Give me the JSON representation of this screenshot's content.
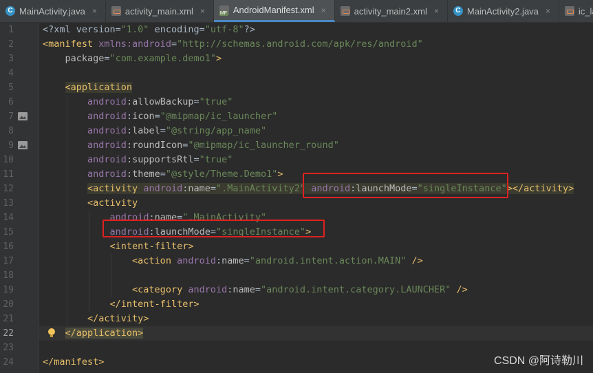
{
  "tabs": [
    {
      "name": "MainActivity.java",
      "icon": "class-icon",
      "active": false
    },
    {
      "name": "activity_main.xml",
      "icon": "xml-file-icon",
      "active": false
    },
    {
      "name": "AndroidManifest.xml",
      "icon": "manifest-file-icon",
      "active": true
    },
    {
      "name": "activity_main2.xml",
      "icon": "xml-file-icon",
      "active": false
    },
    {
      "name": "MainActivity2.java",
      "icon": "class-icon",
      "active": false
    },
    {
      "name": "ic_launcher_r",
      "icon": "xml-file-icon",
      "active": false
    }
  ],
  "close_glyph": "×",
  "current_line": 22,
  "lines": [
    [
      [
        "t-plain",
        "<?xml version="
      ],
      [
        "t-val",
        "\"1.0\""
      ],
      [
        "t-plain",
        " encoding="
      ],
      [
        "t-val",
        "\"utf-8\""
      ],
      [
        "t-plain",
        "?>"
      ]
    ],
    [
      [
        "t-tag",
        "<manifest "
      ],
      [
        "t-ns",
        "xmlns:android"
      ],
      [
        "t-plain",
        "="
      ],
      [
        "t-val",
        "\"http://schemas.android.com/apk/res/android\""
      ]
    ],
    [
      [
        "t-plain",
        "    "
      ],
      [
        "t-attr",
        "package"
      ],
      [
        "t-plain",
        "="
      ],
      [
        "t-val",
        "\"com.example.demo1\""
      ],
      [
        "t-tag",
        ">"
      ]
    ],
    [],
    [
      [
        "t-plain",
        "    "
      ],
      [
        "t-tag hl",
        "<application"
      ]
    ],
    [
      [
        "t-plain",
        "        "
      ],
      [
        "t-ns",
        "android"
      ],
      [
        "t-plain",
        ":"
      ],
      [
        "t-attr",
        "allowBackup"
      ],
      [
        "t-plain",
        "="
      ],
      [
        "t-val",
        "\"true\""
      ]
    ],
    [
      [
        "t-plain",
        "        "
      ],
      [
        "t-ns",
        "android"
      ],
      [
        "t-plain",
        ":"
      ],
      [
        "t-attr",
        "icon"
      ],
      [
        "t-plain",
        "="
      ],
      [
        "t-val",
        "\"@mipmap/ic_launcher\""
      ]
    ],
    [
      [
        "t-plain",
        "        "
      ],
      [
        "t-ns",
        "android"
      ],
      [
        "t-plain",
        ":"
      ],
      [
        "t-attr",
        "label"
      ],
      [
        "t-plain",
        "="
      ],
      [
        "t-val",
        "\"@string/app_name\""
      ]
    ],
    [
      [
        "t-plain",
        "        "
      ],
      [
        "t-ns",
        "android"
      ],
      [
        "t-plain",
        ":"
      ],
      [
        "t-attr",
        "roundIcon"
      ],
      [
        "t-plain",
        "="
      ],
      [
        "t-val",
        "\"@mipmap/ic_launcher_round\""
      ]
    ],
    [
      [
        "t-plain",
        "        "
      ],
      [
        "t-ns",
        "android"
      ],
      [
        "t-plain",
        ":"
      ],
      [
        "t-attr",
        "supportsRtl"
      ],
      [
        "t-plain",
        "="
      ],
      [
        "t-val",
        "\"true\""
      ]
    ],
    [
      [
        "t-plain",
        "        "
      ],
      [
        "t-ns",
        "android"
      ],
      [
        "t-plain",
        ":"
      ],
      [
        "t-attr",
        "theme"
      ],
      [
        "t-plain",
        "="
      ],
      [
        "t-val",
        "\"@style/Theme.Demo1\""
      ],
      [
        "t-tag",
        ">"
      ]
    ],
    [
      [
        "t-plain",
        "        "
      ],
      [
        "t-tag hl",
        "<activity "
      ],
      [
        "t-ns hl",
        "android"
      ],
      [
        "t-plain hl",
        ":"
      ],
      [
        "t-attr hl",
        "name"
      ],
      [
        "t-plain hl",
        "="
      ],
      [
        "t-val hl",
        "\".MainActivity2\" "
      ],
      [
        "t-ns hl",
        "android"
      ],
      [
        "t-plain hl",
        ":"
      ],
      [
        "t-attr hl",
        "launchMode"
      ],
      [
        "t-plain hl",
        "="
      ],
      [
        "t-val hl",
        "\"singleInstance\""
      ],
      [
        "t-tag hl",
        "></activity>"
      ]
    ],
    [
      [
        "t-plain",
        "        "
      ],
      [
        "t-tag",
        "<activity"
      ]
    ],
    [
      [
        "t-plain",
        "            "
      ],
      [
        "t-ns",
        "android"
      ],
      [
        "t-plain",
        ":"
      ],
      [
        "t-attr",
        "name"
      ],
      [
        "t-plain",
        "="
      ],
      [
        "t-val",
        "\".MainActivity\""
      ]
    ],
    [
      [
        "t-plain",
        "            "
      ],
      [
        "t-ns",
        "android"
      ],
      [
        "t-plain",
        ":"
      ],
      [
        "t-attr",
        "launchMode"
      ],
      [
        "t-plain",
        "="
      ],
      [
        "t-val",
        "\"singleInstance\""
      ],
      [
        "t-tag",
        ">"
      ]
    ],
    [
      [
        "t-plain",
        "            "
      ],
      [
        "t-tag",
        "<intent-filter>"
      ]
    ],
    [
      [
        "t-plain",
        "                "
      ],
      [
        "t-tag",
        "<action "
      ],
      [
        "t-ns",
        "android"
      ],
      [
        "t-plain",
        ":"
      ],
      [
        "t-attr",
        "name"
      ],
      [
        "t-plain",
        "="
      ],
      [
        "t-val",
        "\"android.intent.action.MAIN\""
      ],
      [
        "t-tag",
        " />"
      ]
    ],
    [],
    [
      [
        "t-plain",
        "                "
      ],
      [
        "t-tag",
        "<category "
      ],
      [
        "t-ns",
        "android"
      ],
      [
        "t-plain",
        ":"
      ],
      [
        "t-attr",
        "name"
      ],
      [
        "t-plain",
        "="
      ],
      [
        "t-val",
        "\"android.intent.category.LAUNCHER\""
      ],
      [
        "t-tag",
        " />"
      ]
    ],
    [
      [
        "t-plain",
        "            "
      ],
      [
        "t-tag",
        "</intent-filter>"
      ]
    ],
    [
      [
        "t-plain",
        "        "
      ],
      [
        "t-tag",
        "</activity>"
      ]
    ],
    [
      [
        "t-plain",
        "    "
      ],
      [
        "t-tag hl2",
        "</application>"
      ]
    ],
    [],
    [
      [
        "t-tag",
        "</manifest>"
      ]
    ]
  ],
  "gutter_image_lines": [
    7,
    9
  ],
  "gutter_bulb_line": 22,
  "watermark": "CSDN @阿诗勒川"
}
